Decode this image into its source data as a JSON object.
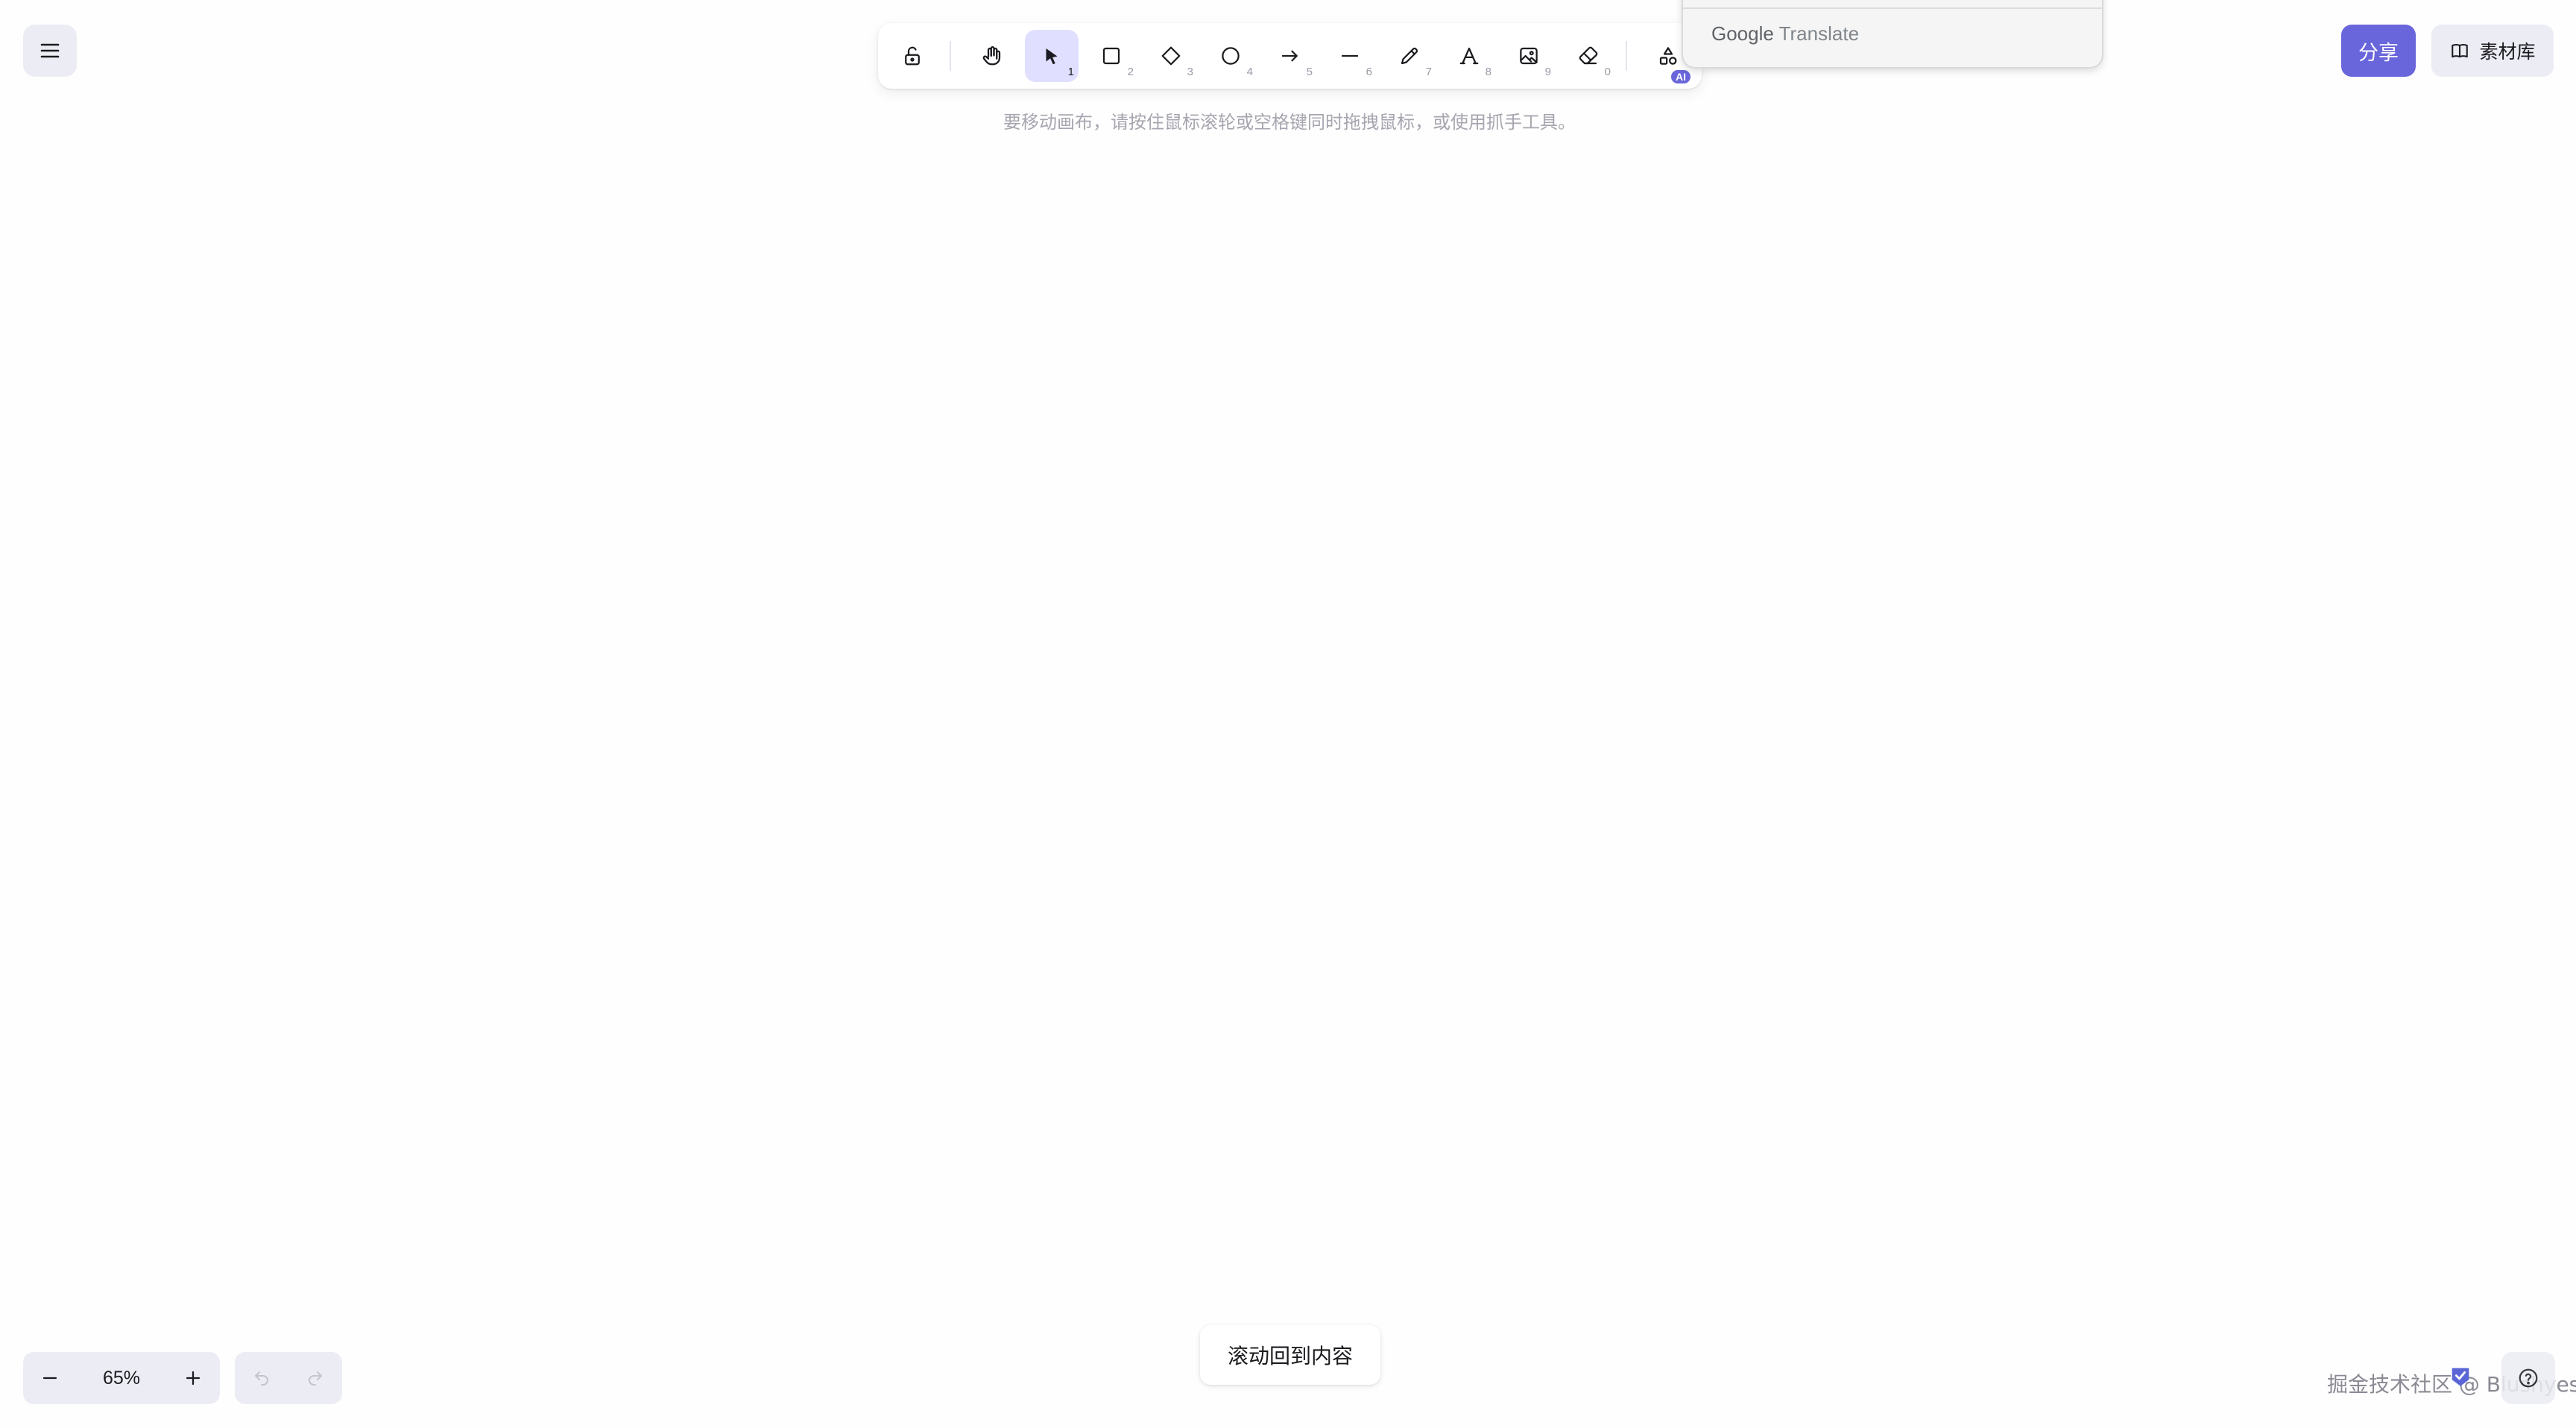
{
  "toolbar": {
    "tools": [
      {
        "name": "lock",
        "icon": "lock-icon",
        "key": ""
      },
      {
        "name": "hand",
        "icon": "hand-icon",
        "key": ""
      },
      {
        "name": "selection",
        "icon": "pointer-icon",
        "key": "1",
        "active": true
      },
      {
        "name": "rectangle",
        "icon": "square-icon",
        "key": "2"
      },
      {
        "name": "diamond",
        "icon": "diamond-icon",
        "key": "3"
      },
      {
        "name": "ellipse",
        "icon": "circle-icon",
        "key": "4"
      },
      {
        "name": "arrow",
        "icon": "arrow-right-icon",
        "key": "5"
      },
      {
        "name": "line",
        "icon": "line-icon",
        "key": "6"
      },
      {
        "name": "draw",
        "icon": "pencil-icon",
        "key": "7"
      },
      {
        "name": "text",
        "icon": "text-icon",
        "key": "8"
      },
      {
        "name": "image",
        "icon": "image-icon",
        "key": "9"
      },
      {
        "name": "eraser",
        "icon": "eraser-icon",
        "key": "0"
      },
      {
        "name": "more-tools",
        "icon": "shapes-icon",
        "key": "",
        "badge": "AI"
      }
    ],
    "hint": "要移动画布，请按住鼠标滚轮或空格键同时拖拽鼠标，或使用抓手工具。"
  },
  "translate_popup": {
    "brand_google": "Google",
    "brand_translate": "Translate"
  },
  "header": {
    "share_label": "分享",
    "library_label": "素材库"
  },
  "zoom": {
    "value": "65%"
  },
  "scroll_back_label": "滚动回到内容",
  "watermark": "掘金技术社区 @ Blushyes",
  "colors": {
    "accent": "#6965db",
    "active_tool_bg": "#e0dfff",
    "island_bg": "#ececf4"
  }
}
